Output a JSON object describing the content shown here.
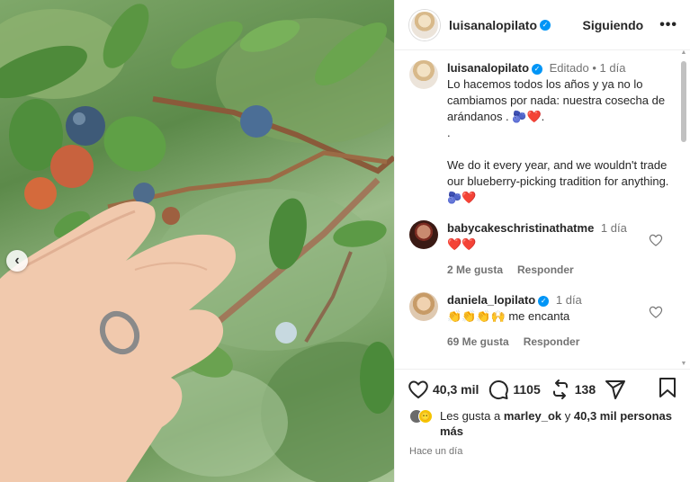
{
  "post": {
    "author": "luisanalopilato",
    "follow_label": "Siguiendo",
    "more_label": "•••",
    "edited_label": "Editado",
    "caption_time": "1 día",
    "caption": "Lo hacemos todos los años y ya no lo cambiamos por nada: nuestra cosecha de arándanos . 🫐❤️.\n.\n\nWe do it every year, and we wouldn't trade our blueberry-picking tradition for anything. 🫐❤️"
  },
  "comments": [
    {
      "user": "babycakeschristinathatme",
      "time": "1 día",
      "text": "❤️❤️",
      "likes_label": "2 Me gusta",
      "reply_label": "Responder",
      "verified": false
    },
    {
      "user": "daniela_lopilato",
      "time": "1 día",
      "text": "👏👏👏🙌 me encanta",
      "likes_label": "69 Me gusta",
      "reply_label": "Responder",
      "verified": true
    }
  ],
  "actions": {
    "like_count": "40,3 mil",
    "comment_count": "1105",
    "repost_count": "138"
  },
  "likes_line": {
    "prefix": "Les gusta a ",
    "user": "marley_ok",
    "middle": " y ",
    "count": "40,3 mil personas",
    "suffix": "más"
  },
  "timestamp": "Hace un día",
  "media_nav_label": "‹",
  "colors": {
    "accent": "#0095f6",
    "heart": "#ed4956",
    "text": "#262626",
    "muted": "#737373"
  },
  "icons": [
    "chevron-left-icon",
    "verified-badge-icon",
    "heart-icon",
    "comment-icon",
    "repost-icon",
    "share-icon",
    "bookmark-icon",
    "more-icon"
  ]
}
